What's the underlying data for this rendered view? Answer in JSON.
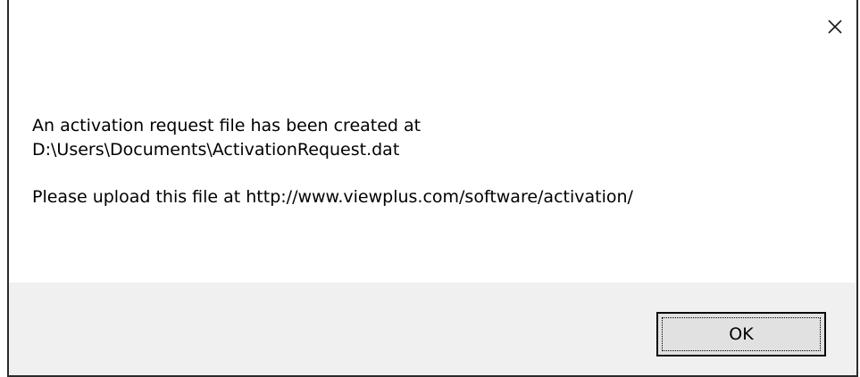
{
  "dialog": {
    "close_icon": "close-icon",
    "message": {
      "line1": "An activation request file has been created at",
      "line2": "D:\\Users\\Documents\\ActivationRequest.dat",
      "line3": "Please upload this file at http://www.viewplus.com/software/activation/"
    },
    "ok_label": "OK"
  }
}
